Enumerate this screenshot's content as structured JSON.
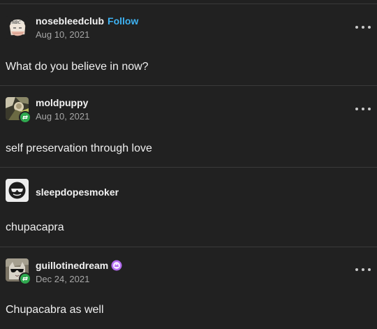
{
  "posts": [
    {
      "username": "nosebleedclub",
      "follow_label": "Follow",
      "date": "Aug 10, 2021",
      "body": "What do you believe in now?",
      "avatar_icon": "nbc-character-avatar",
      "reblogged": false
    },
    {
      "username": "moldpuppy",
      "date": "Aug 10, 2021",
      "body": "self preservation through love",
      "avatar_icon": "photo-avatar",
      "reblogged": true
    },
    {
      "username": "sleepdopesmoker",
      "body": "chupacapra",
      "avatar_icon": "sunglasses-face-avatar",
      "reblogged": false
    },
    {
      "username": "guillotinedream",
      "date": "Dec 24, 2021",
      "body": "Chupacabra as well",
      "avatar_icon": "cat-sunglasses-avatar",
      "reblogged": true,
      "badge_icon": "premium-badge-icon"
    }
  ],
  "colors": {
    "background": "#212121",
    "follow": "#3eb2f2",
    "reblog": "#2fa84f",
    "badge": "#b46cf0"
  }
}
